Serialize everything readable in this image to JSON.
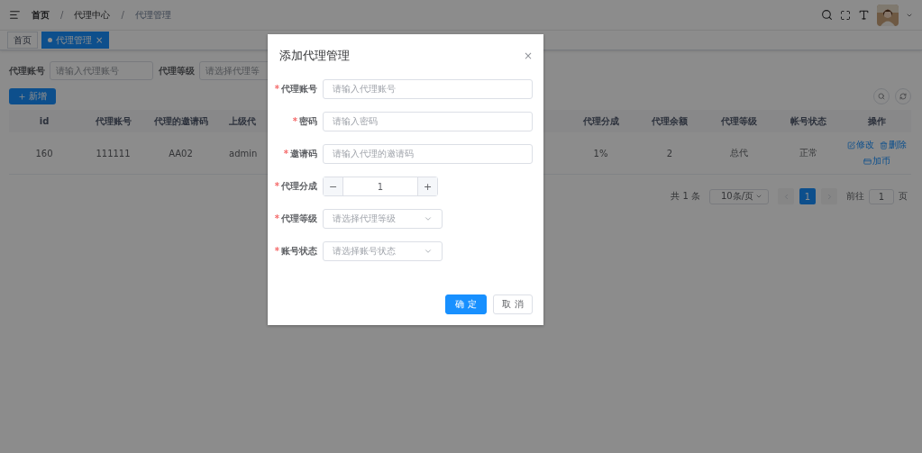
{
  "header": {
    "breadcrumb": [
      {
        "label": "首页"
      },
      {
        "separator": "/",
        "label": "代理中心"
      },
      {
        "separator": "/",
        "label": "代理管理"
      }
    ]
  },
  "tabs": [
    {
      "label": "首页",
      "selected": false
    },
    {
      "label": "代理管理",
      "selected": true,
      "close": "×"
    }
  ],
  "filters": [
    {
      "label": "代理账号",
      "placeholder": "请输入代理账号"
    },
    {
      "label": "代理等级",
      "placeholder": "请选择代理等"
    }
  ],
  "add_button": "新增",
  "table": {
    "left_columns": [
      "id",
      "代理账号",
      "代理的邀请码",
      "上级代"
    ],
    "right_columns": [
      "代理分成",
      "代理余额",
      "代理等级",
      "帐号状态",
      "操作"
    ],
    "rows": [
      {
        "left_cells": [
          "160",
          "111111",
          "AA02",
          "admin"
        ],
        "right_cells": [
          "1%",
          "2",
          "总代",
          "正常"
        ],
        "actions": [
          {
            "kind": "edit",
            "label": "修改"
          },
          {
            "kind": "delete",
            "label": "删除"
          },
          {
            "kind": "coin",
            "label": "加币"
          }
        ]
      }
    ]
  },
  "pagination": {
    "total": "共 1 条",
    "page_size": "10条/页",
    "pages": [
      {
        "label": "1",
        "selected": true
      }
    ],
    "goto_label": "前往",
    "goto_value": "1",
    "goto_suffix": "页"
  },
  "dialog": {
    "title": "添加代理管理",
    "close": "×",
    "required_mark": "*",
    "fields": [
      {
        "kind": "input",
        "label": "代理账号",
        "required": true,
        "placeholder": "请输入代理账号"
      },
      {
        "kind": "input",
        "label": "密码",
        "required": true,
        "placeholder": "请输入密码"
      },
      {
        "kind": "input",
        "label": "邀请码",
        "required": true,
        "placeholder": "请输入代理的邀请码"
      },
      {
        "kind": "stepper",
        "label": "代理分成",
        "required": true,
        "value": "1",
        "minus": "−",
        "plus": "+"
      },
      {
        "kind": "select",
        "label": "代理等级",
        "required": true,
        "placeholder": "请选择代理等级"
      },
      {
        "kind": "select",
        "label": "账号状态",
        "required": true,
        "placeholder": "请选择账号状态"
      }
    ],
    "buttons": [
      {
        "kind": "primary",
        "label": "确 定"
      },
      {
        "kind": "default",
        "label": "取 消"
      }
    ]
  }
}
